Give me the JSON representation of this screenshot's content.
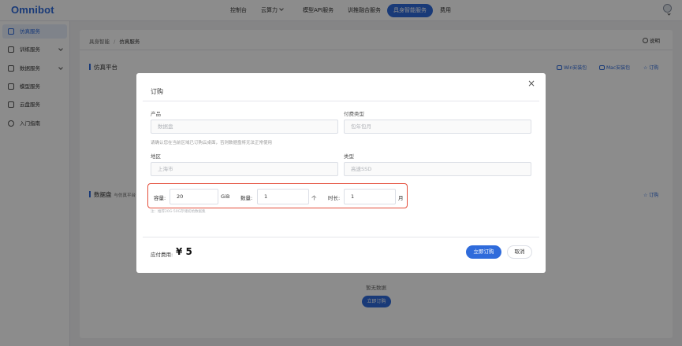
{
  "brand": {
    "logo": "Omnibot",
    "accent": "#2f6bdb",
    "warn": "#e44d3a"
  },
  "nav": {
    "items": [
      "控制台",
      "云算力",
      "模型API服务",
      "训推融合服务",
      "具身智能服务",
      "费用"
    ],
    "active": "具身智能服务"
  },
  "sidebar": {
    "items": [
      {
        "label": "仿真服务",
        "icon": "document-icon"
      },
      {
        "label": "训练服务",
        "icon": "shield-icon"
      },
      {
        "label": "数据服务",
        "icon": "database-icon"
      },
      {
        "label": "模型服务",
        "icon": "cube-icon"
      },
      {
        "label": "云盘服务",
        "icon": "disk-icon"
      },
      {
        "label": "入门指南",
        "icon": "gear-icon"
      }
    ]
  },
  "page": {
    "breadcrumb": [
      "具身智能",
      "仿真服务"
    ],
    "separator": "/",
    "help": "说明",
    "sim_section": {
      "title": "仿真平台",
      "links": [
        "Win安装包",
        "Mac安装包",
        "订购"
      ]
    },
    "disk_section": {
      "title": "数据盘",
      "subtitle": "与仿真平台",
      "link": "订购"
    },
    "empty_text": "暂无数据",
    "empty_button": "立即订购"
  },
  "modal": {
    "title": "订购",
    "close": "×",
    "product": {
      "label": "产品",
      "placeholder": "数据盘"
    },
    "billing": {
      "label": "付费类型",
      "placeholder": "包年包月"
    },
    "hint": "请确认您在当前区域已订购云桌面，否则数据盘将无法正常使用",
    "region": {
      "label": "地区",
      "placeholder": "上海市"
    },
    "type": {
      "label": "类型",
      "placeholder": "高速SSD"
    },
    "capacity": {
      "label": "容量:",
      "value": "20",
      "unit": "GiB"
    },
    "quantity": {
      "label": "数量:",
      "value": "1",
      "unit": "个"
    },
    "duration": {
      "label": "时长:",
      "value": "1",
      "unit": "月"
    },
    "note": "注：推荐20G-50G存储初始数据集",
    "fee_label": "应付费用:",
    "fee_value": "¥ 5",
    "submit": "立即订购",
    "cancel": "取消"
  }
}
